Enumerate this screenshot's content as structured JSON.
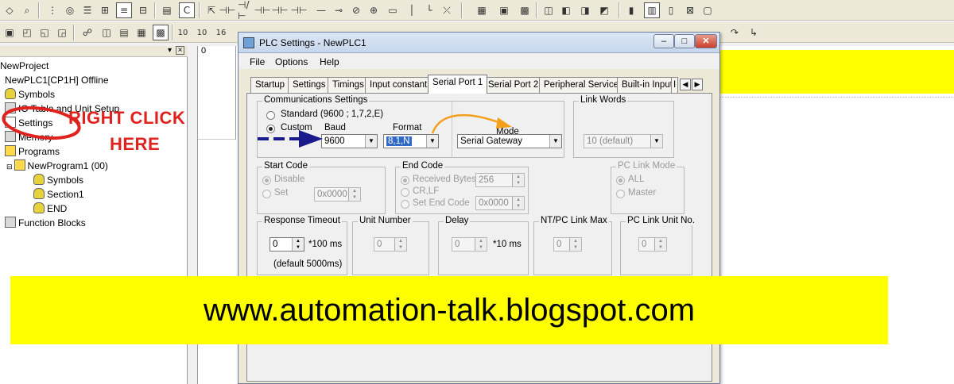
{
  "tree": {
    "items": [
      {
        "label": "NewProject"
      },
      {
        "label": "NewPLC1[CP1H] Offline"
      },
      {
        "label": "Symbols"
      },
      {
        "label": "IO Table and Unit Setup"
      },
      {
        "label": "Settings"
      },
      {
        "label": "Memory"
      },
      {
        "label": "Programs"
      },
      {
        "label": "NewProgram1 (00)"
      },
      {
        "label": "Symbols"
      },
      {
        "label": "Section1"
      },
      {
        "label": "END"
      },
      {
        "label": "Function Blocks"
      }
    ]
  },
  "ladder": {
    "rung_number": "0"
  },
  "dialog": {
    "title": "PLC Settings - NewPLC1",
    "menu": [
      "File",
      "Options",
      "Help"
    ],
    "tabs": [
      "Startup",
      "Settings",
      "Timings",
      "Input constant",
      "Serial Port 1",
      "Serial Port 2",
      "Peripheral Service",
      "Built-in Input",
      "I"
    ],
    "active_tab": "Serial Port 1",
    "comm": {
      "legend": "Communications Settings",
      "standard_label": "Standard (9600 ; 1,7,2,E)",
      "custom_label": "Custom",
      "selected": "Custom",
      "baud_label": "Baud",
      "baud_value": "9600",
      "format_label": "Format",
      "format_value": "8,1,N",
      "mode_label": "Mode",
      "mode_value": "Serial Gateway"
    },
    "link_words": {
      "legend": "Link Words",
      "value": "10 (default)"
    },
    "start_code": {
      "legend": "Start Code",
      "disable": "Disable",
      "set": "Set",
      "value": "0x0000"
    },
    "end_code": {
      "legend": "End Code",
      "received": "Received Bytes",
      "received_value": "256",
      "crlf": "CR,LF",
      "set_end": "Set End Code",
      "set_end_value": "0x0000"
    },
    "pc_link_mode": {
      "legend": "PC Link Mode",
      "all": "ALL",
      "master": "Master"
    },
    "response_timeout": {
      "legend": "Response Timeout",
      "value": "0",
      "unit": "*100 ms",
      "note": "(default 5000ms)"
    },
    "unit_number": {
      "legend": "Unit Number",
      "value": "0"
    },
    "delay": {
      "legend": "Delay",
      "value": "0",
      "unit": "*10 ms"
    },
    "nt_pc_link_max": {
      "legend": "NT/PC Link Max",
      "value": "0"
    },
    "pc_link_unit_no": {
      "legend": "PC Link Unit No.",
      "value": "0"
    }
  },
  "annotation": {
    "right_click": "RIGHT CLICK",
    "here": "HERE",
    "banner": "www.automation-talk.blogspot.com",
    "colors": {
      "banner": "#ffff00",
      "annotation_red": "#e0221e",
      "arrow_blue": "#1a1a8c",
      "arrow_orange": "#f5a01a"
    }
  },
  "toolbar": {
    "labels": [
      "10",
      "10",
      "16"
    ]
  }
}
